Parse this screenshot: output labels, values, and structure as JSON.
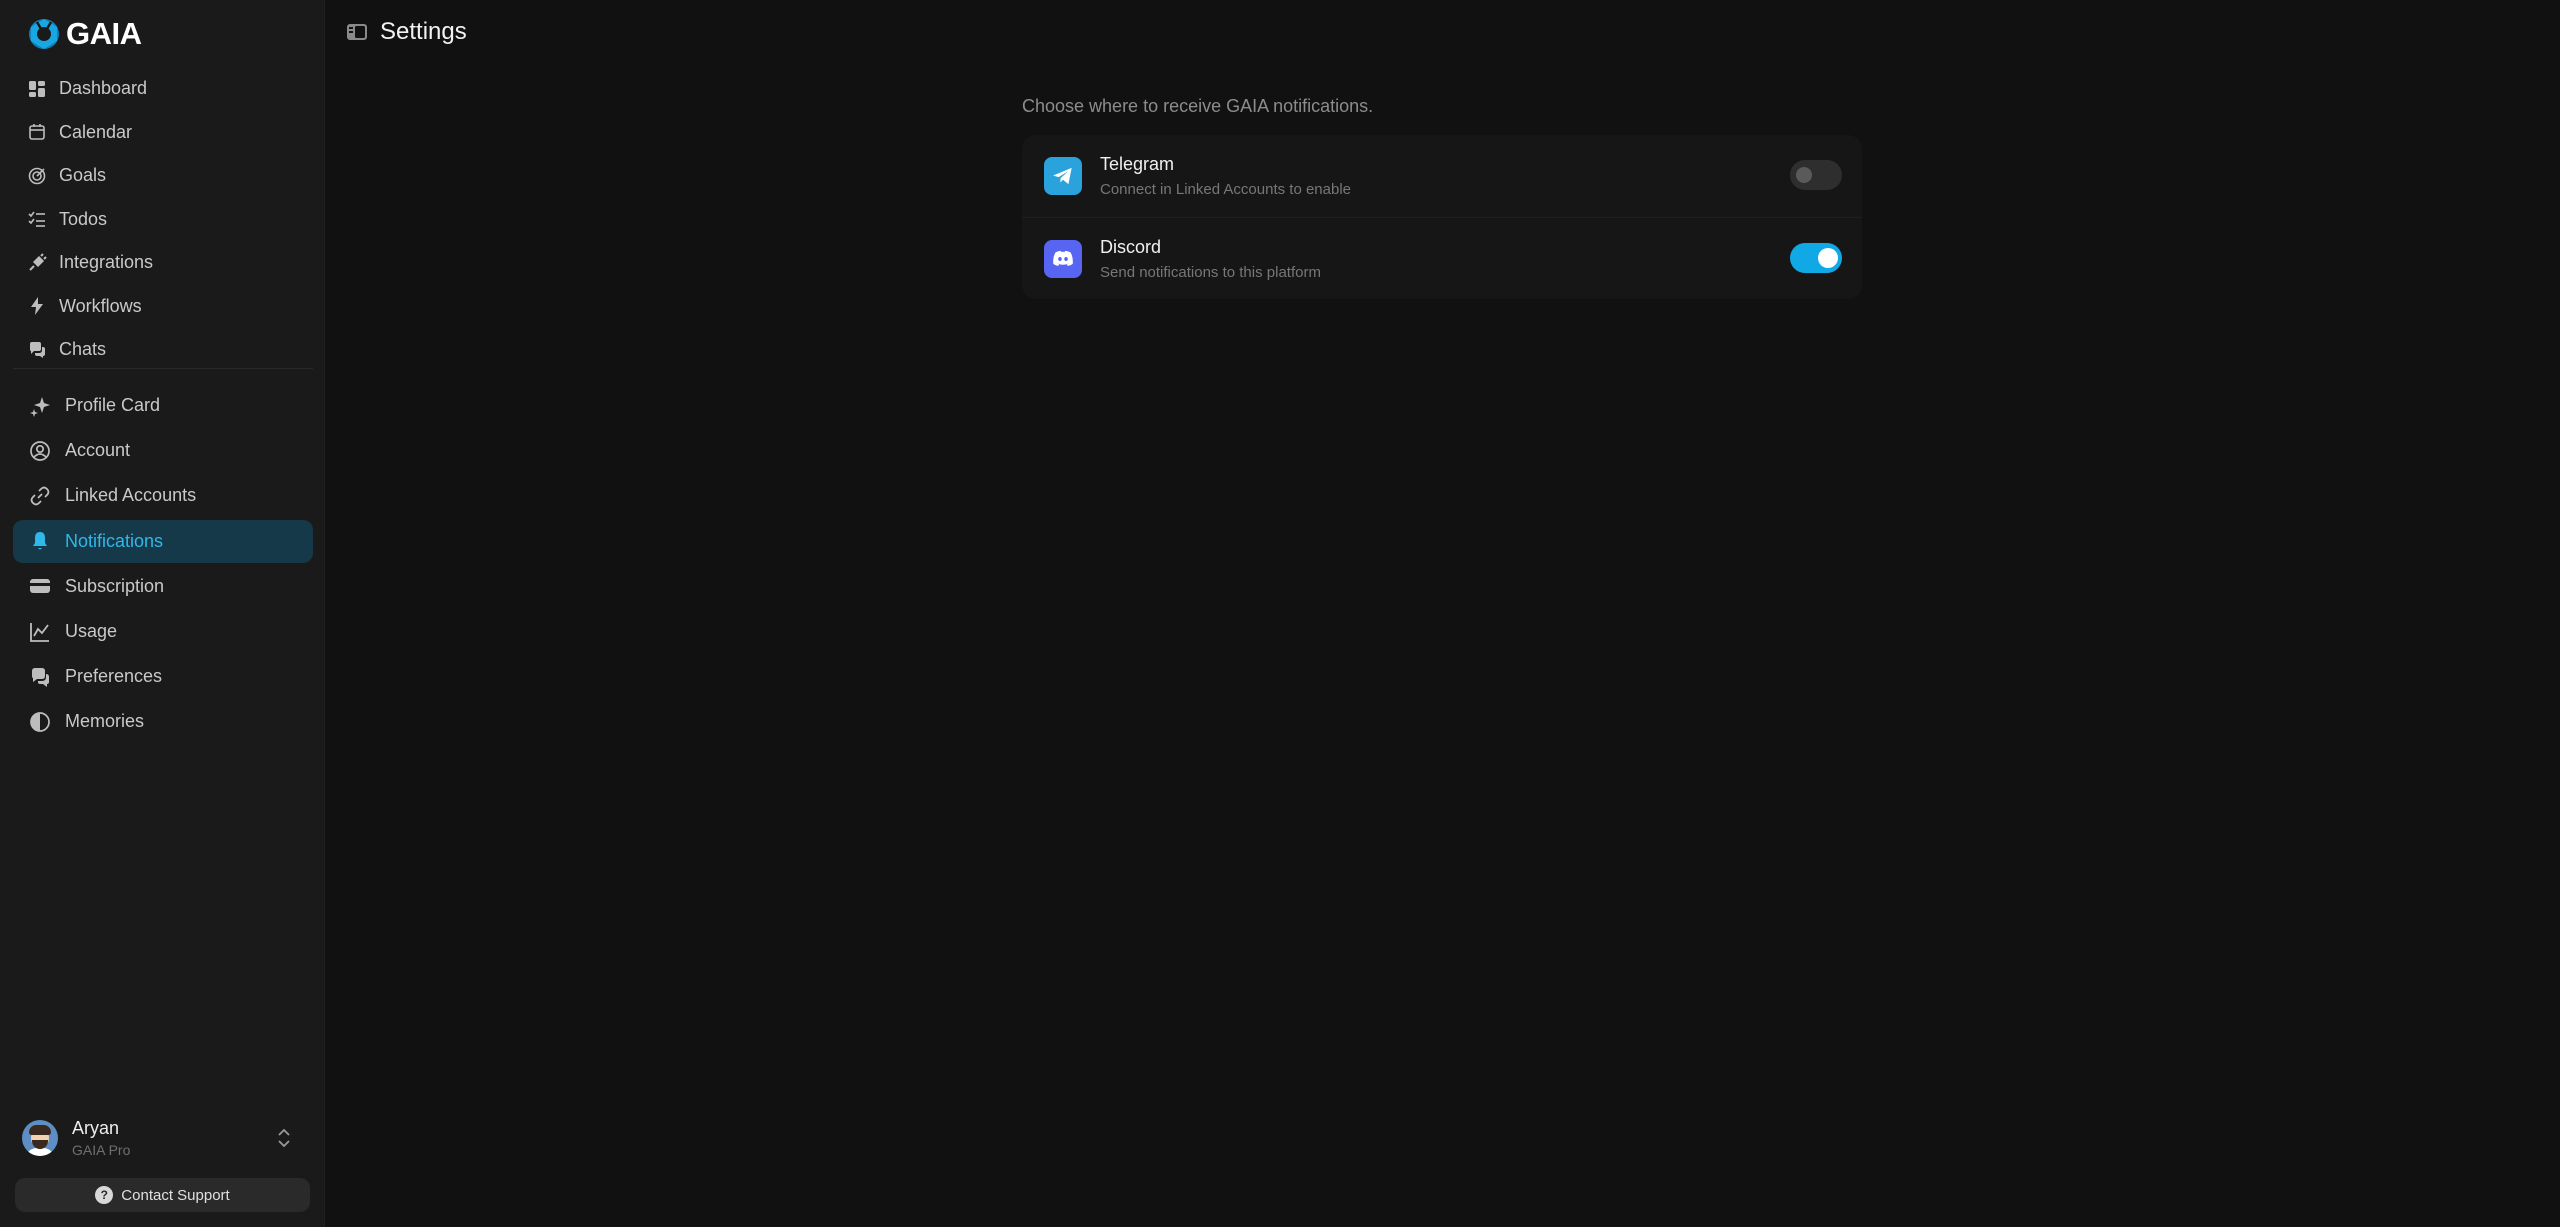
{
  "brand": {
    "name": "GAIA"
  },
  "sidebar": {
    "main_items": [
      {
        "label": "Dashboard",
        "icon": "dashboard-icon"
      },
      {
        "label": "Calendar",
        "icon": "calendar-icon"
      },
      {
        "label": "Goals",
        "icon": "target-icon"
      },
      {
        "label": "Todos",
        "icon": "checklist-icon"
      },
      {
        "label": "Integrations",
        "icon": "plug-icon"
      },
      {
        "label": "Workflows",
        "icon": "lightning-icon"
      },
      {
        "label": "Chats",
        "icon": "chat-bubbles-icon"
      }
    ],
    "settings_items": [
      {
        "label": "Profile Card",
        "icon": "sparkles-icon"
      },
      {
        "label": "Account",
        "icon": "user-circle-icon"
      },
      {
        "label": "Linked Accounts",
        "icon": "link-icon"
      },
      {
        "label": "Notifications",
        "icon": "bell-icon",
        "active": true
      },
      {
        "label": "Subscription",
        "icon": "credit-card-icon"
      },
      {
        "label": "Usage",
        "icon": "line-chart-icon"
      },
      {
        "label": "Preferences",
        "icon": "chat-bubbles-icon"
      },
      {
        "label": "Memories",
        "icon": "brain-icon"
      }
    ]
  },
  "user": {
    "name": "Aryan",
    "plan": "GAIA Pro"
  },
  "support": {
    "label": "Contact Support"
  },
  "header": {
    "title": "Settings"
  },
  "notifications": {
    "intro": "Choose where to receive GAIA notifications.",
    "platforms": [
      {
        "name": "Telegram",
        "description": "Connect in Linked Accounts to enable",
        "enabled": false,
        "icon": "telegram-icon"
      },
      {
        "name": "Discord",
        "description": "Send notifications to this platform",
        "enabled": true,
        "icon": "discord-icon"
      }
    ]
  },
  "colors": {
    "accent": "#11a8e6",
    "active_bg": "#16394a",
    "active_text": "#2fb8e8",
    "background": "#111111",
    "sidebar": "#1a1a1a"
  }
}
